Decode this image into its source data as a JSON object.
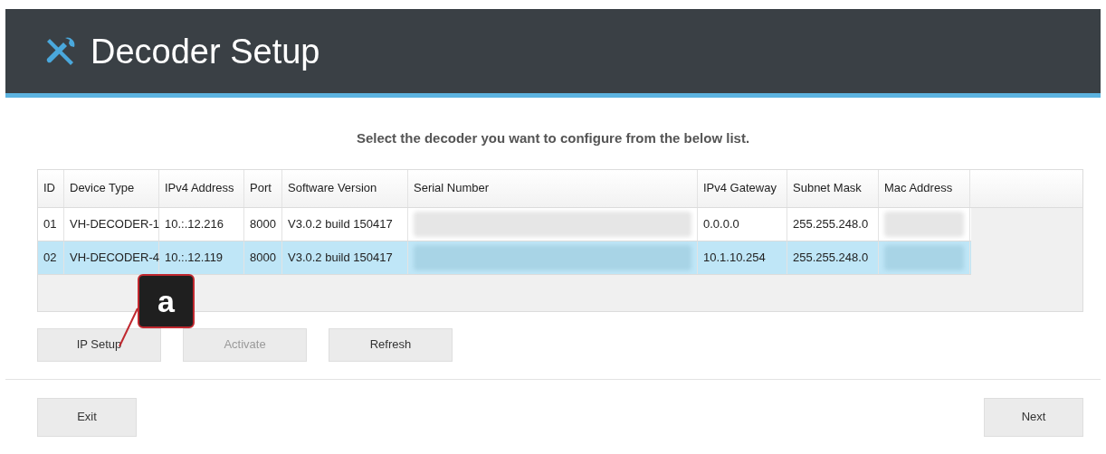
{
  "header": {
    "title": "Decoder Setup"
  },
  "instruction": "Select the decoder you want to configure from the below list.",
  "table": {
    "columns": [
      "ID",
      "Device Type",
      "IPv4 Address",
      "Port",
      "Software Version",
      "Serial Number",
      "IPv4 Gateway",
      "Subnet Mask",
      "Mac Address"
    ],
    "rows": [
      {
        "selected": false,
        "cells": [
          {
            "kind": "text",
            "text": "01"
          },
          {
            "kind": "text",
            "text": "VH-DECODER-1"
          },
          {
            "kind": "text",
            "text": "10.:.12.216"
          },
          {
            "kind": "text",
            "text": "8000"
          },
          {
            "kind": "text",
            "text": "V3.0.2 build 150417"
          },
          {
            "kind": "redacted"
          },
          {
            "kind": "text",
            "text": "0.0.0.0"
          },
          {
            "kind": "text",
            "text": "255.255.248.0"
          },
          {
            "kind": "redacted"
          }
        ]
      },
      {
        "selected": true,
        "cells": [
          {
            "kind": "text",
            "text": "02"
          },
          {
            "kind": "text",
            "text": "VH-DECODER-4"
          },
          {
            "kind": "text",
            "text": "10.:.12.119"
          },
          {
            "kind": "text",
            "text": "8000"
          },
          {
            "kind": "text",
            "text": "V3.0.2 build 150417"
          },
          {
            "kind": "redacted"
          },
          {
            "kind": "text",
            "text": "10.1.10.254"
          },
          {
            "kind": "text",
            "text": "255.255.248.0"
          },
          {
            "kind": "redacted"
          }
        ]
      }
    ]
  },
  "actions": [
    {
      "label": "IP Setup",
      "disabled": false
    },
    {
      "label": "Activate",
      "disabled": true
    },
    {
      "label": "Refresh",
      "disabled": false
    }
  ],
  "callout": {
    "label": "a"
  },
  "footer": {
    "buttons": [
      "Exit",
      "Next"
    ]
  }
}
